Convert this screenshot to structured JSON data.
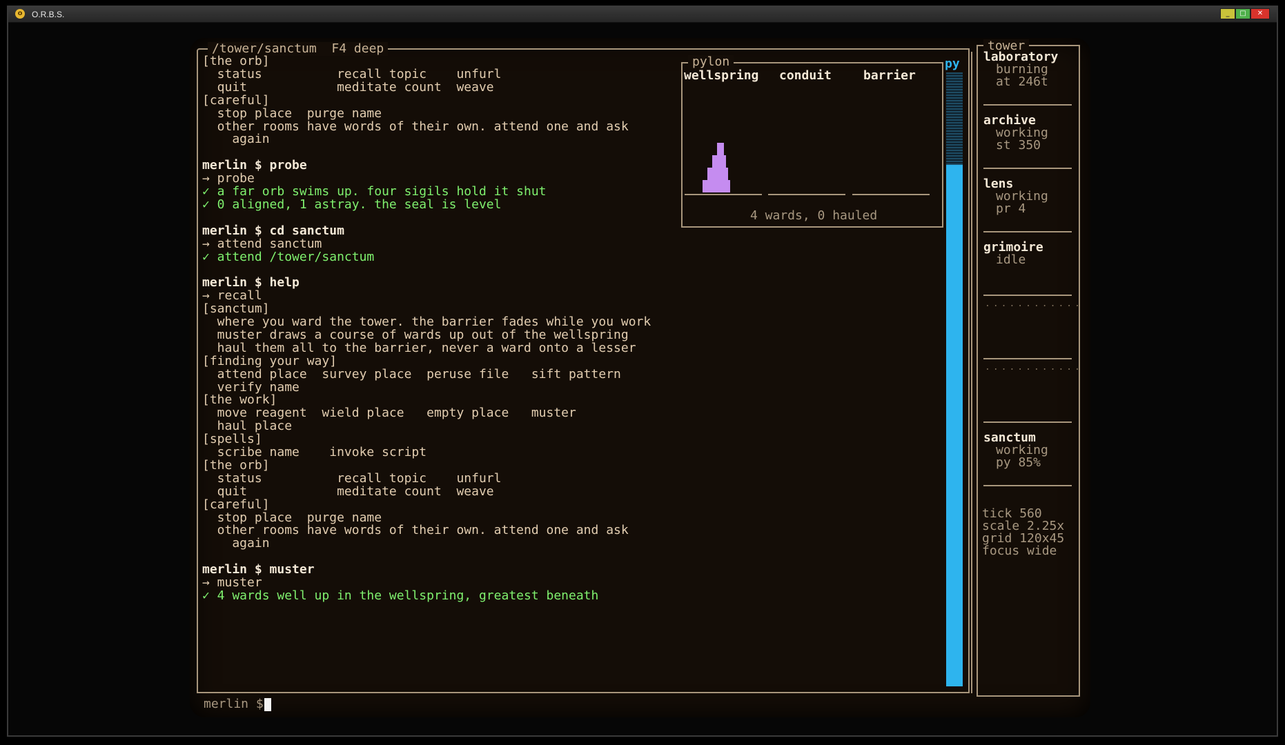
{
  "window": {
    "title": "O.R.B.S.",
    "icon": "orb-app-icon",
    "controls": [
      "_",
      "□",
      "✕"
    ]
  },
  "console": {
    "path_label": "/tower/sanctum  F4 deep",
    "lines": [
      {
        "text": "[the orb]",
        "style": "n"
      },
      {
        "text": "  status          recall topic    unfurl",
        "style": "n"
      },
      {
        "text": "  quit            meditate count  weave",
        "style": "n"
      },
      {
        "text": "[careful]",
        "style": "n"
      },
      {
        "text": "  stop place  purge name",
        "style": "n"
      },
      {
        "text": "  other rooms have words of their own. attend one and ask",
        "style": "n"
      },
      {
        "text": "    again",
        "style": "n"
      },
      {
        "text": "",
        "style": "n"
      },
      {
        "text": "merlin $ probe",
        "style": "b"
      },
      {
        "text": "→ probe",
        "style": "n"
      },
      {
        "text": "✓ a far orb swims up. four sigils hold it shut",
        "style": "g"
      },
      {
        "text": "✓ 0 aligned, 1 astray. the seal is level",
        "style": "g"
      },
      {
        "text": "",
        "style": "n"
      },
      {
        "text": "merlin $ cd sanctum",
        "style": "b"
      },
      {
        "text": "→ attend sanctum",
        "style": "n"
      },
      {
        "text": "✓ attend /tower/sanctum",
        "style": "g"
      },
      {
        "text": "",
        "style": "n"
      },
      {
        "text": "merlin $ help",
        "style": "b"
      },
      {
        "text": "→ recall",
        "style": "n"
      },
      {
        "text": "[sanctum]",
        "style": "n"
      },
      {
        "text": "  where you ward the tower. the barrier fades while you work",
        "style": "n"
      },
      {
        "text": "  muster draws a course of wards up out of the wellspring",
        "style": "n"
      },
      {
        "text": "  haul them all to the barrier, never a ward onto a lesser",
        "style": "n"
      },
      {
        "text": "[finding your way]",
        "style": "n"
      },
      {
        "text": "  attend place  survey place  peruse file   sift pattern",
        "style": "n"
      },
      {
        "text": "  verify name",
        "style": "n"
      },
      {
        "text": "[the work]",
        "style": "n"
      },
      {
        "text": "  move reagent  wield place   empty place   muster",
        "style": "n"
      },
      {
        "text": "  haul place",
        "style": "n"
      },
      {
        "text": "[spells]",
        "style": "n"
      },
      {
        "text": "  scribe name    invoke script",
        "style": "n"
      },
      {
        "text": "[the orb]",
        "style": "n"
      },
      {
        "text": "  status          recall topic    unfurl",
        "style": "n"
      },
      {
        "text": "  quit            meditate count  weave",
        "style": "n"
      },
      {
        "text": "[careful]",
        "style": "n"
      },
      {
        "text": "  stop place  purge name",
        "style": "n"
      },
      {
        "text": "  other rooms have words of their own. attend one and ask",
        "style": "n"
      },
      {
        "text": "    again",
        "style": "n"
      },
      {
        "text": "",
        "style": "n"
      },
      {
        "text": "merlin $ muster",
        "style": "b"
      },
      {
        "text": "→ muster",
        "style": "n"
      },
      {
        "text": "✓ 4 wards well up in the wellspring, greatest beneath",
        "style": "g"
      }
    ],
    "prompt": "merlin $"
  },
  "pylon": {
    "title": "pylon",
    "columns": [
      "wellspring",
      "conduit",
      "barrier"
    ],
    "stacks": [
      [
        1,
        2,
        3,
        4
      ],
      [],
      []
    ],
    "ward_color": "#c58cf0",
    "summary": "4 wards, 0 hauled"
  },
  "gauge": {
    "label": "py",
    "value": 0.85,
    "color": "#2eb4ee"
  },
  "tower": {
    "title": "tower",
    "rooms": [
      {
        "name": "laboratory",
        "state": "burning",
        "detail": "at 246t"
      },
      {
        "name": "archive",
        "state": "working",
        "detail": "st 350"
      },
      {
        "name": "lens",
        "state": "working",
        "detail": "pr 4"
      },
      {
        "name": "grimoire",
        "state": "idle",
        "detail": ""
      },
      {
        "name": "",
        "state": "",
        "detail": ""
      },
      {
        "name": "",
        "state": "",
        "detail": ""
      },
      {
        "name": "sanctum",
        "state": "working",
        "detail": "py 85%"
      }
    ],
    "stats": [
      {
        "key": "tick",
        "value": "560"
      },
      {
        "key": "scale",
        "value": "2.25x"
      },
      {
        "key": "grid",
        "value": "120x45"
      },
      {
        "key": "focus",
        "value": "wide"
      }
    ]
  }
}
